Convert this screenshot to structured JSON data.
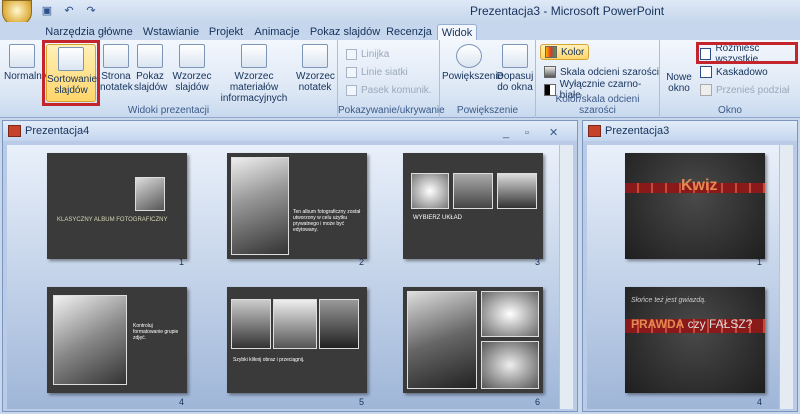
{
  "window_title": "Prezentacja3 - Microsoft PowerPoint",
  "qat": {
    "save_icon": "save-icon",
    "undo_icon": "undo-icon",
    "redo_icon": "redo-icon"
  },
  "tabs": [
    "Narzędzia główne",
    "Wstawianie",
    "Projekt",
    "Animacje",
    "Pokaz slajdów",
    "Recenzja",
    "Widok"
  ],
  "active_tab": "Widok",
  "groups": {
    "views": {
      "label": "Widoki prezentacji",
      "buttons": [
        "Normalny",
        "Sortowanie slajdów",
        "Strona notatek",
        "Pokaz slajdów",
        "Wzorzec slajdów",
        "Wzorzec materiałów informacyjnych",
        "Wzorzec notatek"
      ]
    },
    "show": {
      "label": "Pokazywanie/ukrywanie",
      "items": [
        "Linijka",
        "Linie siatki",
        "Pasek komunik."
      ]
    },
    "zoom": {
      "label": "Powiększenie",
      "buttons": [
        "Powiększenie",
        "Dopasuj do okna"
      ]
    },
    "color": {
      "label": "Kolor/skala odcieni szarości",
      "items": [
        "Kolor",
        "Skala odcieni szarości",
        "Wyłącznie czarno-białe"
      ]
    },
    "window": {
      "label": "Okno",
      "new_window": "Nowe okno",
      "items": [
        "Rozmieść wszystkie",
        "Kaskadowo",
        "Przenieś podział"
      ]
    }
  },
  "left_panel": {
    "title": "Prezentacja4",
    "slides": [
      {
        "num": "1",
        "title": "KLASYCZNY ALBUM FOTOGRAFICZNY"
      },
      {
        "num": "2",
        "text": "Ten album fotograficzny został utworzony w celu użytku prywatnego i może być edytowany."
      },
      {
        "num": "3",
        "title": "WYBIERZ UKŁAD"
      },
      {
        "num": "4",
        "text": "Kontroluj formatowanie grupie zdjęć."
      },
      {
        "num": "5",
        "text": "Szybki kliknij obraz i przeciągnij."
      },
      {
        "num": "6"
      }
    ]
  },
  "right_panel": {
    "title": "Prezentacja3",
    "slides": [
      {
        "num": "1",
        "title": "Kwiz"
      },
      {
        "num": "4",
        "subtitle": "Słońce też jest gwiazdą.",
        "title_a": "PRAWDA",
        "title_b": " czy FAŁSZ?"
      }
    ]
  },
  "colors": {
    "accent": "#c4242b",
    "ribbon": "#dbe6f4"
  }
}
